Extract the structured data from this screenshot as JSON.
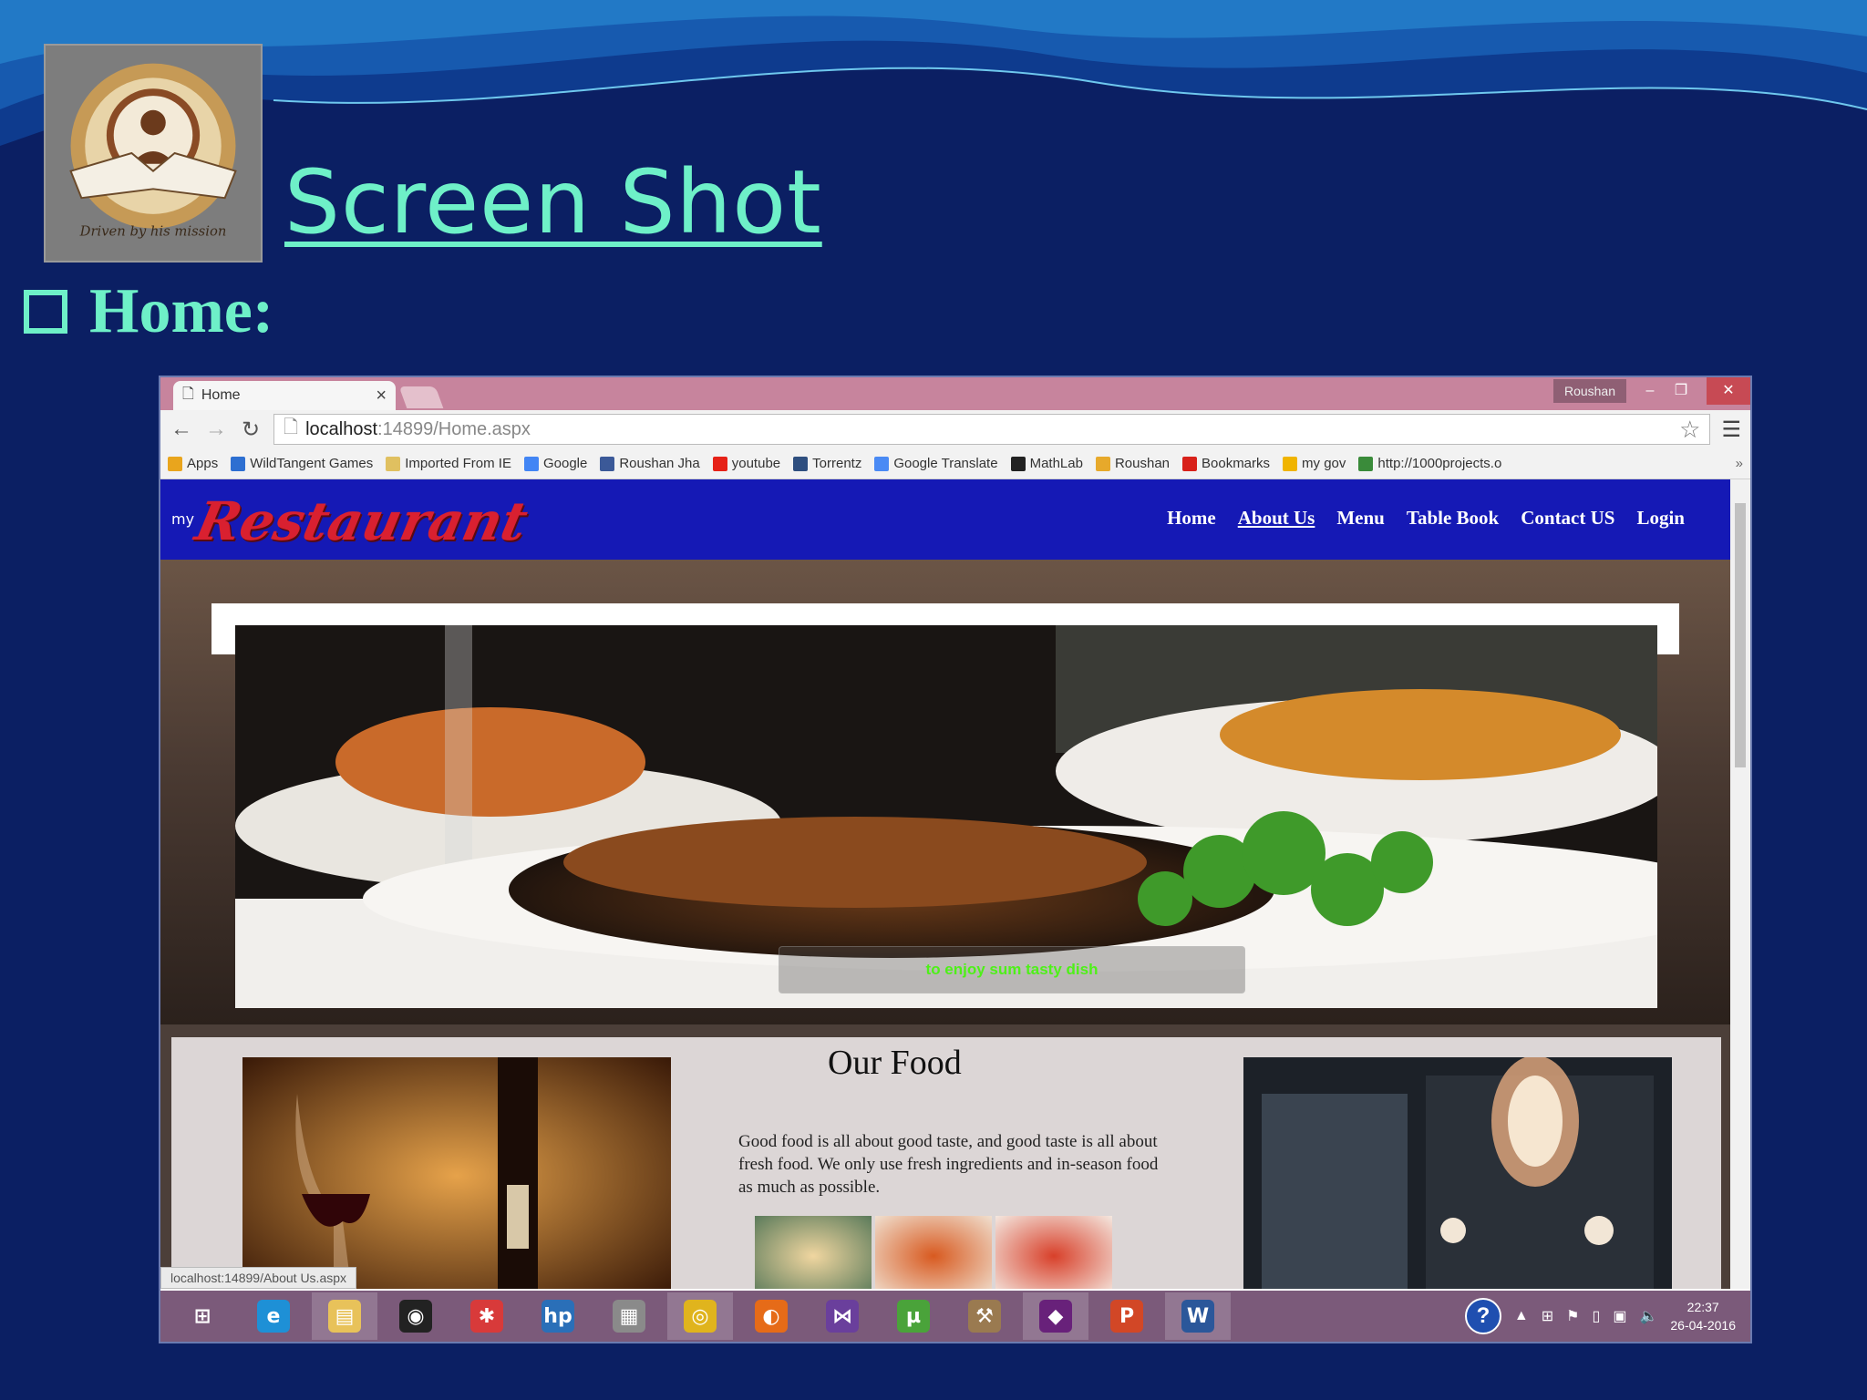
{
  "slide": {
    "title": "Screen Shot",
    "bullet": "Home:",
    "logo_text": "Driven by his mission"
  },
  "browser": {
    "tab_title": "Home",
    "window_user": "Roushan",
    "url_host": "localhost",
    "url_path": ":14899/Home.aspx",
    "bookmarks": [
      {
        "label": "Apps",
        "icon": "apps-grid-icon",
        "color": "#e9a51d"
      },
      {
        "label": "WildTangent Games",
        "icon": "wildtangent-icon",
        "color": "#2d6fd1"
      },
      {
        "label": "Imported From IE",
        "icon": "folder-icon",
        "color": "#e0c060"
      },
      {
        "label": "Google",
        "icon": "google-icon",
        "color": "#4285f4"
      },
      {
        "label": "Roushan Jha",
        "icon": "facebook-icon",
        "color": "#3b5998"
      },
      {
        "label": "youtube",
        "icon": "youtube-icon",
        "color": "#e62117"
      },
      {
        "label": "Torrentz",
        "icon": "torrentz-icon",
        "color": "#2f4f7f"
      },
      {
        "label": "Google Translate",
        "icon": "translate-icon",
        "color": "#4a8af4"
      },
      {
        "label": "MathLab",
        "icon": "mathlab-icon",
        "color": "#222222"
      },
      {
        "label": "Roushan",
        "icon": "roushan-icon",
        "color": "#e7a92b"
      },
      {
        "label": "Bookmarks",
        "icon": "bookmarks-icon",
        "color": "#d8211a"
      },
      {
        "label": "my gov",
        "icon": "mygov-icon",
        "color": "#f0b400"
      },
      {
        "label": "http://1000projects.o",
        "icon": "projects-icon",
        "color": "#3a8b3a"
      }
    ],
    "status_url": "localhost:14899/About Us.aspx"
  },
  "site": {
    "logo_my": "my",
    "logo_text": "Restaurant",
    "menu": [
      {
        "label": "Home",
        "active": false
      },
      {
        "label": "About Us",
        "active": true
      },
      {
        "label": "Menu",
        "active": false
      },
      {
        "label": "Table Book",
        "active": false
      },
      {
        "label": "Contact US",
        "active": false
      },
      {
        "label": "Login",
        "active": false
      }
    ],
    "hero_caption": "to enjoy sum tasty dish",
    "food_title": "Our Food",
    "food_text": "Good food is all about good taste, and good taste is all about fresh food. We only use fresh ingredients and in-season food as much as possible."
  },
  "taskbar": {
    "apps": [
      {
        "name": "windows-start-icon",
        "color": "#7b5a7a",
        "glyph": "⊞",
        "active": false
      },
      {
        "name": "internet-explorer-icon",
        "color": "#1e90d6",
        "glyph": "e",
        "active": false
      },
      {
        "name": "file-explorer-icon",
        "color": "#e8c25a",
        "glyph": "▤",
        "active": true
      },
      {
        "name": "camera-app-icon",
        "color": "#222222",
        "glyph": "◉",
        "active": false
      },
      {
        "name": "photos-app-icon",
        "color": "#d83a3a",
        "glyph": "✱",
        "active": false
      },
      {
        "name": "hp-icon",
        "color": "#2a6fb8",
        "glyph": "hp",
        "active": false
      },
      {
        "name": "keyboard-app-icon",
        "color": "#8a8a8a",
        "glyph": "▦",
        "active": false
      },
      {
        "name": "chrome-icon",
        "color": "#e0b41d",
        "glyph": "◎",
        "active": true
      },
      {
        "name": "firefox-icon",
        "color": "#e66b18",
        "glyph": "◐",
        "active": false
      },
      {
        "name": "visual-studio-express-icon",
        "color": "#6a3f9c",
        "glyph": "⋈",
        "active": false
      },
      {
        "name": "utorrent-icon",
        "color": "#4aa33a",
        "glyph": "µ",
        "active": false
      },
      {
        "name": "tools-app-icon",
        "color": "#9a7a50",
        "glyph": "⚒",
        "active": false
      },
      {
        "name": "visual-studio-icon",
        "color": "#68217a",
        "glyph": "◆",
        "active": true
      },
      {
        "name": "powerpoint-icon",
        "color": "#d24726",
        "glyph": "P",
        "active": false
      },
      {
        "name": "word-icon",
        "color": "#2b579a",
        "glyph": "W",
        "active": true
      }
    ],
    "time": "22:37",
    "date": "26-04-2016"
  }
}
